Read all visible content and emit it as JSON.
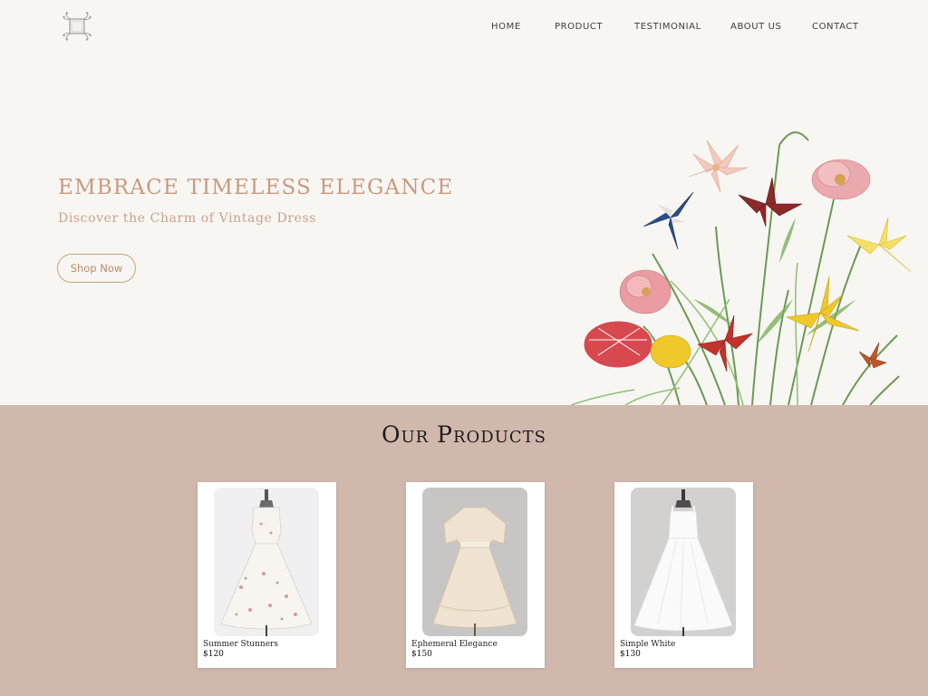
{
  "brand": {
    "logo_icon": "floral-frame-logo-icon"
  },
  "nav": {
    "items": [
      {
        "label": "HOME"
      },
      {
        "label": "PRODUCT"
      },
      {
        "label": "TESTIMONIAL"
      },
      {
        "label": "ABOUT US"
      },
      {
        "label": "CONTACT"
      }
    ]
  },
  "hero": {
    "title": "EMBRACE TIMELESS ELEGANCE",
    "subtitle": "Discover the Charm of Vintage Dress",
    "cta_label": "Shop Now",
    "illustration_icon": "wildflower-bouquet-illustration"
  },
  "products": {
    "heading": "Our Products",
    "items": [
      {
        "name": "Summer Stunners",
        "price": "$120",
        "image_icon": "floral-print-dress-image"
      },
      {
        "name": "Ephemeral Elegance",
        "price": "$150",
        "image_icon": "lace-blouse-dress-image"
      },
      {
        "name": "Simple White",
        "price": "$130",
        "image_icon": "white-tulle-dress-image"
      }
    ]
  },
  "colors": {
    "hero_bg": "#f8f6f3",
    "products_bg": "#d0b8ad",
    "accent": "#c89a7e",
    "button_border": "#c7a57f"
  }
}
